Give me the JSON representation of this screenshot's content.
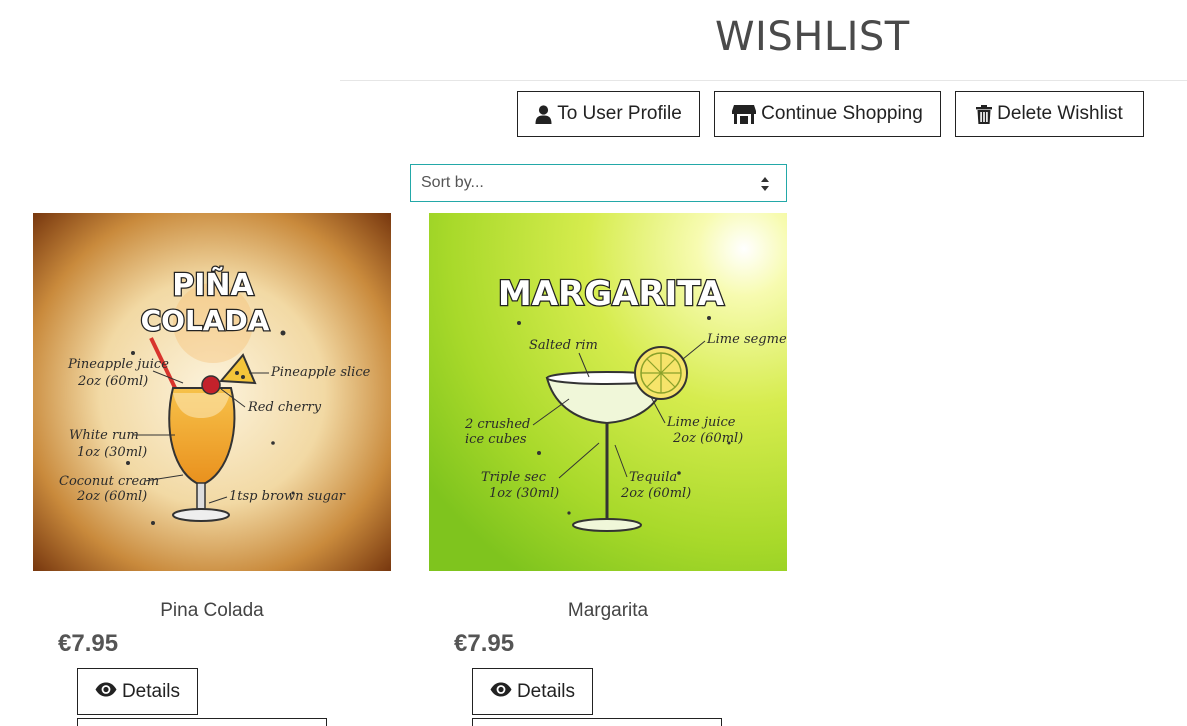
{
  "page": {
    "title": "WISHLIST"
  },
  "toolbar": {
    "profile_label": "To User Profile",
    "shopping_label": "Continue Shopping",
    "delete_label": "Delete Wishlist"
  },
  "sort": {
    "label": "Sort by..."
  },
  "products": [
    {
      "name": "Pina Colada",
      "price": "€7.95",
      "details_label": "Details",
      "image": {
        "title_line1": "PIÑA",
        "title_line2": "COLADA",
        "notes": [
          "Pineapple juice",
          "2oz (60ml)",
          "Pineapple slice",
          "Red cherry",
          "White rum",
          "1oz (30ml)",
          "Coconut cream",
          "2oz (60ml)",
          "1tsp brown sugar"
        ]
      }
    },
    {
      "name": "Margarita",
      "price": "€7.95",
      "details_label": "Details",
      "image": {
        "title": "MARGARITA",
        "notes": [
          "Salted rim",
          "Lime segment",
          "2 crushed",
          "ice cubes",
          "Lime juice",
          "2oz (60ml)",
          "Triple sec",
          "1oz (30ml)",
          "Tequila",
          "2oz (60ml)"
        ]
      }
    }
  ],
  "colors": {
    "accent_border": "#23a8a8",
    "button_border": "#222222",
    "text": "#555555"
  }
}
